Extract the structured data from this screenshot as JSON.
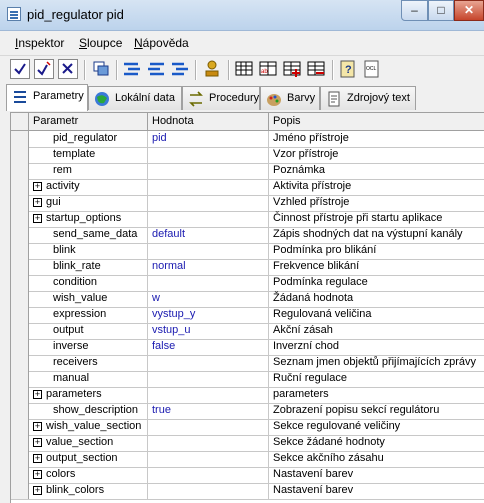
{
  "window": {
    "title": "pid_regulator pid"
  },
  "menu": [
    {
      "pre": "",
      "u": "I",
      "post": "nspektor"
    },
    {
      "pre": "",
      "u": "S",
      "post": "loupce"
    },
    {
      "pre": "",
      "u": "N",
      "post": "ápověda"
    }
  ],
  "tabs": [
    {
      "label": "Parametry",
      "active": true
    },
    {
      "label": "Lokální data"
    },
    {
      "label": "Procedury"
    },
    {
      "label": "Barvy"
    },
    {
      "label": "Zdrojový text"
    }
  ],
  "columns": {
    "param": "Parametr",
    "value": "Hodnota",
    "desc": "Popis"
  },
  "rows": [
    {
      "name": "pid_regulator",
      "value": "pid",
      "desc": "Jméno přístroje",
      "expandable": false
    },
    {
      "name": "template",
      "value": "",
      "desc": "Vzor přístroje",
      "expandable": false
    },
    {
      "name": "rem",
      "value": "",
      "desc": "Poznámka",
      "expandable": false
    },
    {
      "name": "activity",
      "value": "",
      "desc": "Aktivita přístroje",
      "expandable": true
    },
    {
      "name": "gui",
      "value": "",
      "desc": "Vzhled přístroje",
      "expandable": true
    },
    {
      "name": "startup_options",
      "value": "",
      "desc": "Činnost přístroje při startu aplikace",
      "expandable": true
    },
    {
      "name": "send_same_data",
      "value": "default",
      "desc": "Zápis shodných dat na výstupní kanály",
      "expandable": false
    },
    {
      "name": "blink",
      "value": "",
      "desc": "Podmínka pro blikání",
      "expandable": false
    },
    {
      "name": "blink_rate",
      "value": "normal",
      "desc": "Frekvence blikání",
      "expandable": false
    },
    {
      "name": "condition",
      "value": "",
      "desc": "Podmínka regulace",
      "expandable": false
    },
    {
      "name": "wish_value",
      "value": "w",
      "desc": "Žádaná hodnota",
      "expandable": false
    },
    {
      "name": "expression",
      "value": "vystup_y",
      "desc": "Regulovaná veličina",
      "expandable": false
    },
    {
      "name": "output",
      "value": "vstup_u",
      "desc": "Akční zásah",
      "expandable": false
    },
    {
      "name": "inverse",
      "value": "false",
      "desc": "Inverzní chod",
      "expandable": false
    },
    {
      "name": "receivers",
      "value": "",
      "desc": "Seznam jmen objektů přijímajících zprávy",
      "expandable": false
    },
    {
      "name": "manual",
      "value": "",
      "desc": "Ruční regulace",
      "expandable": false
    },
    {
      "name": "parameters",
      "value": "",
      "desc": "parameters",
      "expandable": true
    },
    {
      "name": "show_description",
      "value": "true",
      "desc": "Zobrazení popisu sekcí regulátoru",
      "expandable": false
    },
    {
      "name": "wish_value_section",
      "value": "",
      "desc": "Sekce regulované veličiny",
      "expandable": true
    },
    {
      "name": "value_section",
      "value": "",
      "desc": "Sekce žádané hodnoty",
      "expandable": true
    },
    {
      "name": "output_section",
      "value": "",
      "desc": "Sekce akčního zásahu",
      "expandable": true
    },
    {
      "name": "colors",
      "value": "",
      "desc": "Nastavení barev",
      "expandable": true
    },
    {
      "name": "blink_colors",
      "value": "",
      "desc": "Nastavení barev",
      "expandable": true
    }
  ]
}
